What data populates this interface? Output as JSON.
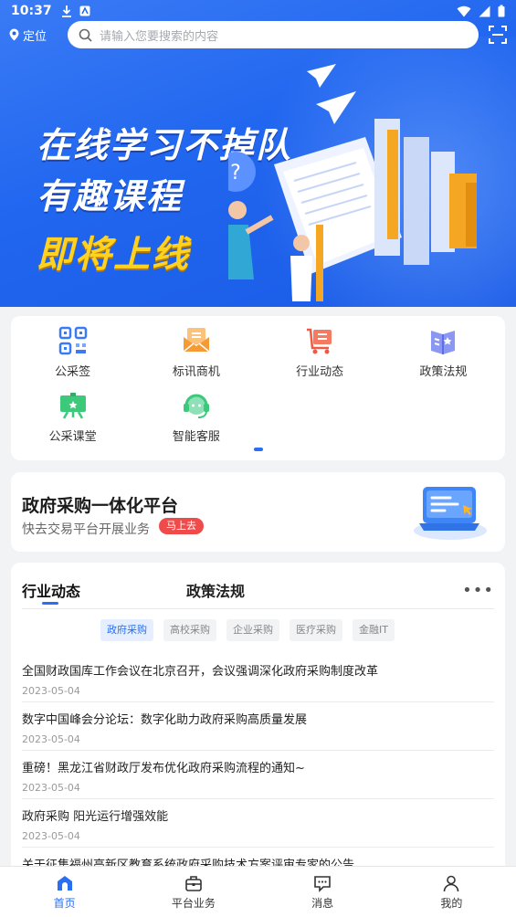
{
  "status_bar": {
    "time": "10:37"
  },
  "header": {
    "location_label": "定位",
    "search_placeholder": "请输入您要搜索的内容"
  },
  "banner": {
    "line1": "在线学习不掉队",
    "line2": "有趣课程",
    "line3": "即将上线"
  },
  "quick_menu": [
    {
      "label": "公采签",
      "icon": "qr-code-icon",
      "color": "#3a7bf5"
    },
    {
      "label": "标讯商机",
      "icon": "mail-icon",
      "color": "#f59a34"
    },
    {
      "label": "行业动态",
      "icon": "cart-list-icon",
      "color": "#f05a42"
    },
    {
      "label": "政策法规",
      "icon": "book-icon",
      "color": "#6b7cf0"
    },
    {
      "label": "公采课堂",
      "icon": "classroom-board-icon",
      "color": "#3cc97a"
    },
    {
      "label": "智能客服",
      "icon": "headset-icon",
      "color": "#5ac88e"
    }
  ],
  "platform": {
    "title": "政府采购一体化平台",
    "subtitle": "快去交易平台开展业务",
    "button": "马上去"
  },
  "news": {
    "tabs": [
      "行业动态",
      "政策法规"
    ],
    "active_tab": "行业动态",
    "categories": [
      "政府采购",
      "高校采购",
      "企业采购",
      "医疗采购",
      "金融IT"
    ],
    "active_category": "政府采购",
    "items": [
      {
        "title": "全国财政国库工作会议在北京召开，会议强调深化政府采购制度改革",
        "date": "2023-05-04"
      },
      {
        "title": "数字中国峰会分论坛：数字化助力政府采购高质量发展",
        "date": "2023-05-04"
      },
      {
        "title": "重磅！黑龙江省财政厅发布优化政府采购流程的通知~",
        "date": "2023-05-04"
      },
      {
        "title": "政府采购 阳光运行增强效能",
        "date": "2023-05-04"
      },
      {
        "title": "关于征集福州高新区教育系统政府采购技术方案评审专家的公告",
        "date": ""
      }
    ]
  },
  "bottom_nav": [
    {
      "label": "首页",
      "icon": "home-icon"
    },
    {
      "label": "平台业务",
      "icon": "briefcase-icon"
    },
    {
      "label": "消息",
      "icon": "message-icon"
    },
    {
      "label": "我的",
      "icon": "user-icon"
    }
  ],
  "colors": {
    "primary": "#2a6ff2",
    "hero_bg": "#2166ef",
    "highlight": "#ffd21f",
    "badge_red": "#ef4b4b"
  }
}
